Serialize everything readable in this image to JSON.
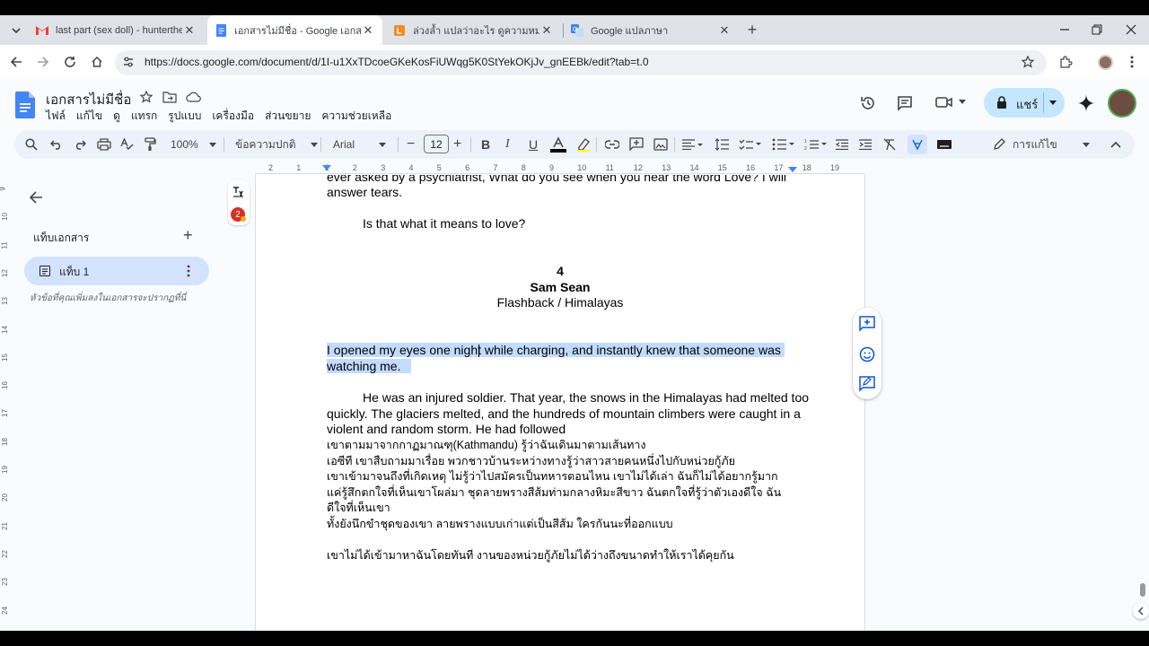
{
  "browser": {
    "tabs": [
      {
        "title": "last part (sex doll) - huntertheri",
        "icon": "gmail-icon",
        "active": false
      },
      {
        "title": "เอกสารไม่มีชื่อ - Google เอกสาร",
        "icon": "docs-icon",
        "active": true
      },
      {
        "title": "ล่วงล้ำ แปลว่าอะไร ดูความหมาย ตัวอ",
        "icon": "dictionary-icon",
        "active": false
      },
      {
        "title": "Google แปลภาษา",
        "icon": "translate-icon",
        "active": false
      }
    ],
    "new_tab": "+",
    "url": "https://docs.google.com/document/d/1I-u1XxTDcoeGKeKosFiUWqg5K0StYekOKjJv_gnEEBk/edit?tab=t.0"
  },
  "docs": {
    "title": "เอกสารไม่มีชื่อ",
    "menu": [
      "ไฟล์",
      "แก้ไข",
      "ดู",
      "แทรก",
      "รูปแบบ",
      "เครื่องมือ",
      "ส่วนขยาย",
      "ความช่วยเหลือ"
    ],
    "share_label": "แชร์",
    "toolbar": {
      "zoom": "100%",
      "style": "ข้อความปกติ",
      "font": "Arial",
      "font_size": "12",
      "mode": "การแก้ไข"
    },
    "ruler": [
      "2",
      "1",
      "1",
      "2",
      "3",
      "4",
      "5",
      "6",
      "7",
      "8",
      "9",
      "10",
      "11",
      "12",
      "13",
      "14",
      "15",
      "16",
      "17",
      "18",
      "19"
    ],
    "vruler": [
      "9",
      "10",
      "11",
      "12",
      "13",
      "14",
      "15",
      "16",
      "17",
      "18",
      "19",
      "20",
      "21",
      "22",
      "23",
      "24"
    ],
    "sidebar": {
      "header": "แท็บเอกสาร",
      "add": "+",
      "tab_label": "แท็บ 1",
      "hint": "หัวข้อที่คุณเพิ่มลงในเอกสารจะปรากฏที่นี่"
    },
    "badge_count": "2",
    "page_lines": [
      "ever asked by a psychiatrist, What do you see when you hear the word Love? I will",
      "answer tears.",
      "Is that what it means to love?",
      "4",
      "Sam Sean",
      "Flashback / Himalayas",
      "I opened my eyes one night while charging, and instantly knew that someone was",
      "watching me.",
      "He was an injured soldier. That year, the snows in the Himalayas had melted too",
      "quickly. The glaciers melted, and the hundreds of mountain climbers were caught in a",
      "violent and random storm. He had followed",
      "เขาตามมาจากกาฏมาณฑุ(Kathmandu) รู้ว่าฉันเดินมาตามเส้นทาง",
      "เอซีที เขาสืบถามมาเรื่อย พวกชาวบ้านระหว่างทางรู้ว่าสาวสายคนหนึ่งไปกับหน่วยกู้ภัย",
      "เขาเข้ามาจนถึงที่เกิดเหตุ ไม่รู้ว่าไปสมัครเป็นทหารตอนไหน เขาไม่ได้เล่า ฉันก็ไม่ได้อยากรู้มาก",
      "แค่รู้สึกตกใจที่เห็นเขาโผล่มา ชุดลายพรางสีส้มท่ามกลางหิมะสีขาว ฉันตกใจที่รู้ว่าตัวเองดีใจ ฉัน",
      "ดีใจที่เห็นเขา",
      "ทั้งยังนึกขำชุดของเขา ลายพรางแบบเก่าแต่เป็นสีส้ม ใครกันนะที่ออกแบบ",
      "เขาไม่ได้เข้ามาหาฉันโดยทันที งานของหน่วยกู้ภัยไม่ได้ว่างถึงขนาดทำให้เราได้คุยกัน"
    ]
  },
  "colors": {
    "accent": "#0b57d0",
    "selection": "#c2dbff",
    "share_bg": "#c2e7ff"
  }
}
